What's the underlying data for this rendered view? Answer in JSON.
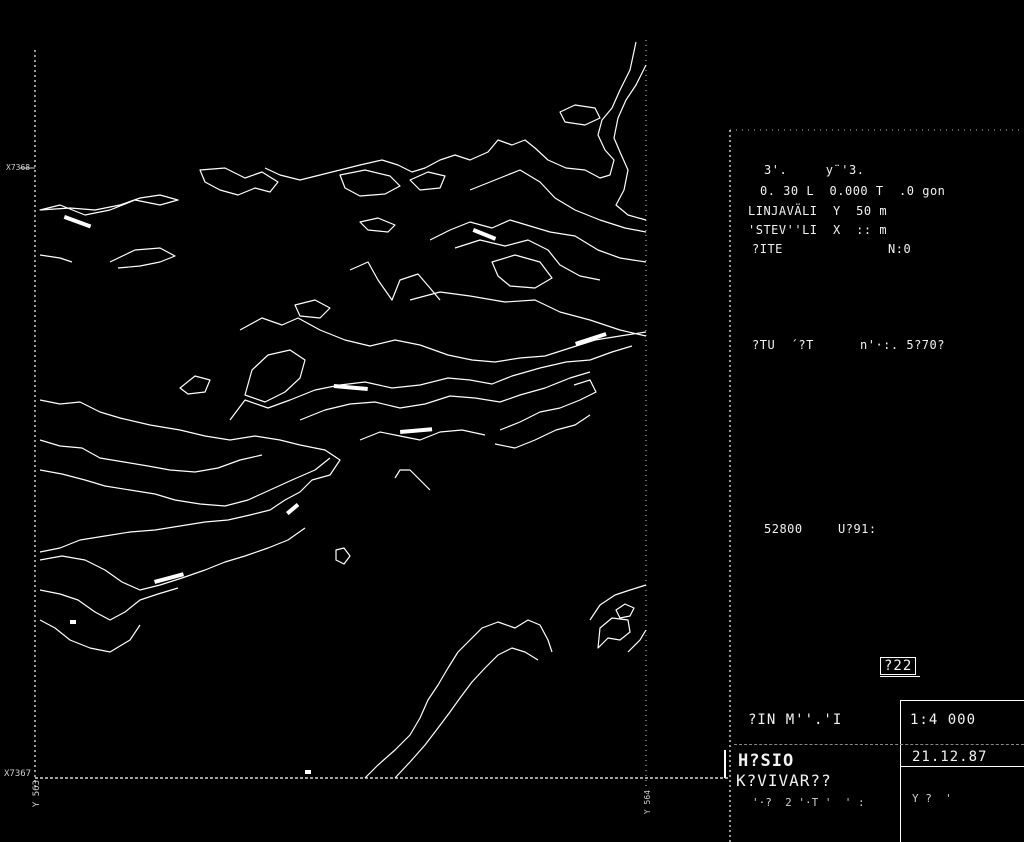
{
  "axes": {
    "x_top": "X7368",
    "x_bottom": "X7367",
    "y_left": "Y 563",
    "y_mid": "Y 564"
  },
  "info": {
    "line1": "3'.     y¨'3.",
    "line2": "0. 30 L  0.000 T  .0 gon",
    "line3": "LINJAVÄLI  Y  50 m",
    "line4": "'STEV''LI  X  :: m",
    "line5": "?ITE",
    "line5_right": "N:0",
    "line6": "?TU  ´?T",
    "line6_right": "n'·:. 5?70?",
    "line7": "52800",
    "line7_right": "U?91:"
  },
  "title_block": {
    "sheet_no": "?22",
    "map_name": "?IN M''.'I",
    "scale": "1:4 000",
    "project": "H?SIO",
    "date": "21.12.87",
    "sub": "K?VIVAR??",
    "note_left": "'·?  2 '·T '  ' :",
    "note_right": "Y ?  '"
  },
  "colors": {
    "background": "#000000",
    "lines": "#ffffff"
  }
}
